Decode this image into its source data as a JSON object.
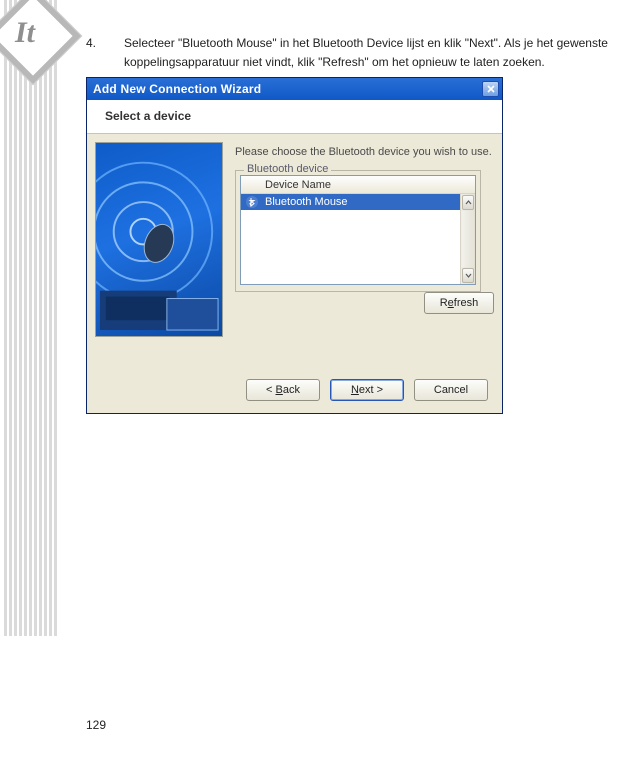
{
  "sidebar": {
    "label": "It"
  },
  "step": {
    "number": "4.",
    "text": "Selecteer \"Bluetooth Mouse\" in het Bluetooth Device lijst en klik \"Next\".    Als je het gewenste koppelingsapparatuur niet vindt, klik \"Refresh\" om het opnieuw te laten zoeken."
  },
  "dialog": {
    "title": "Add New Connection Wizard",
    "subheader": "Select a device",
    "instruction": "Please choose the Bluetooth device you wish to use.",
    "group_label": "Bluetooth device",
    "list_header": "Device Name",
    "selected_item": "Bluetooth Mouse",
    "buttons": {
      "refresh_pre": "R",
      "refresh_u": "e",
      "refresh_post": "fresh",
      "back_pre": "< ",
      "back_u": "B",
      "back_post": "ack",
      "next_u": "N",
      "next_post": "ext >",
      "cancel": "Cancel"
    }
  },
  "page_number": "129"
}
